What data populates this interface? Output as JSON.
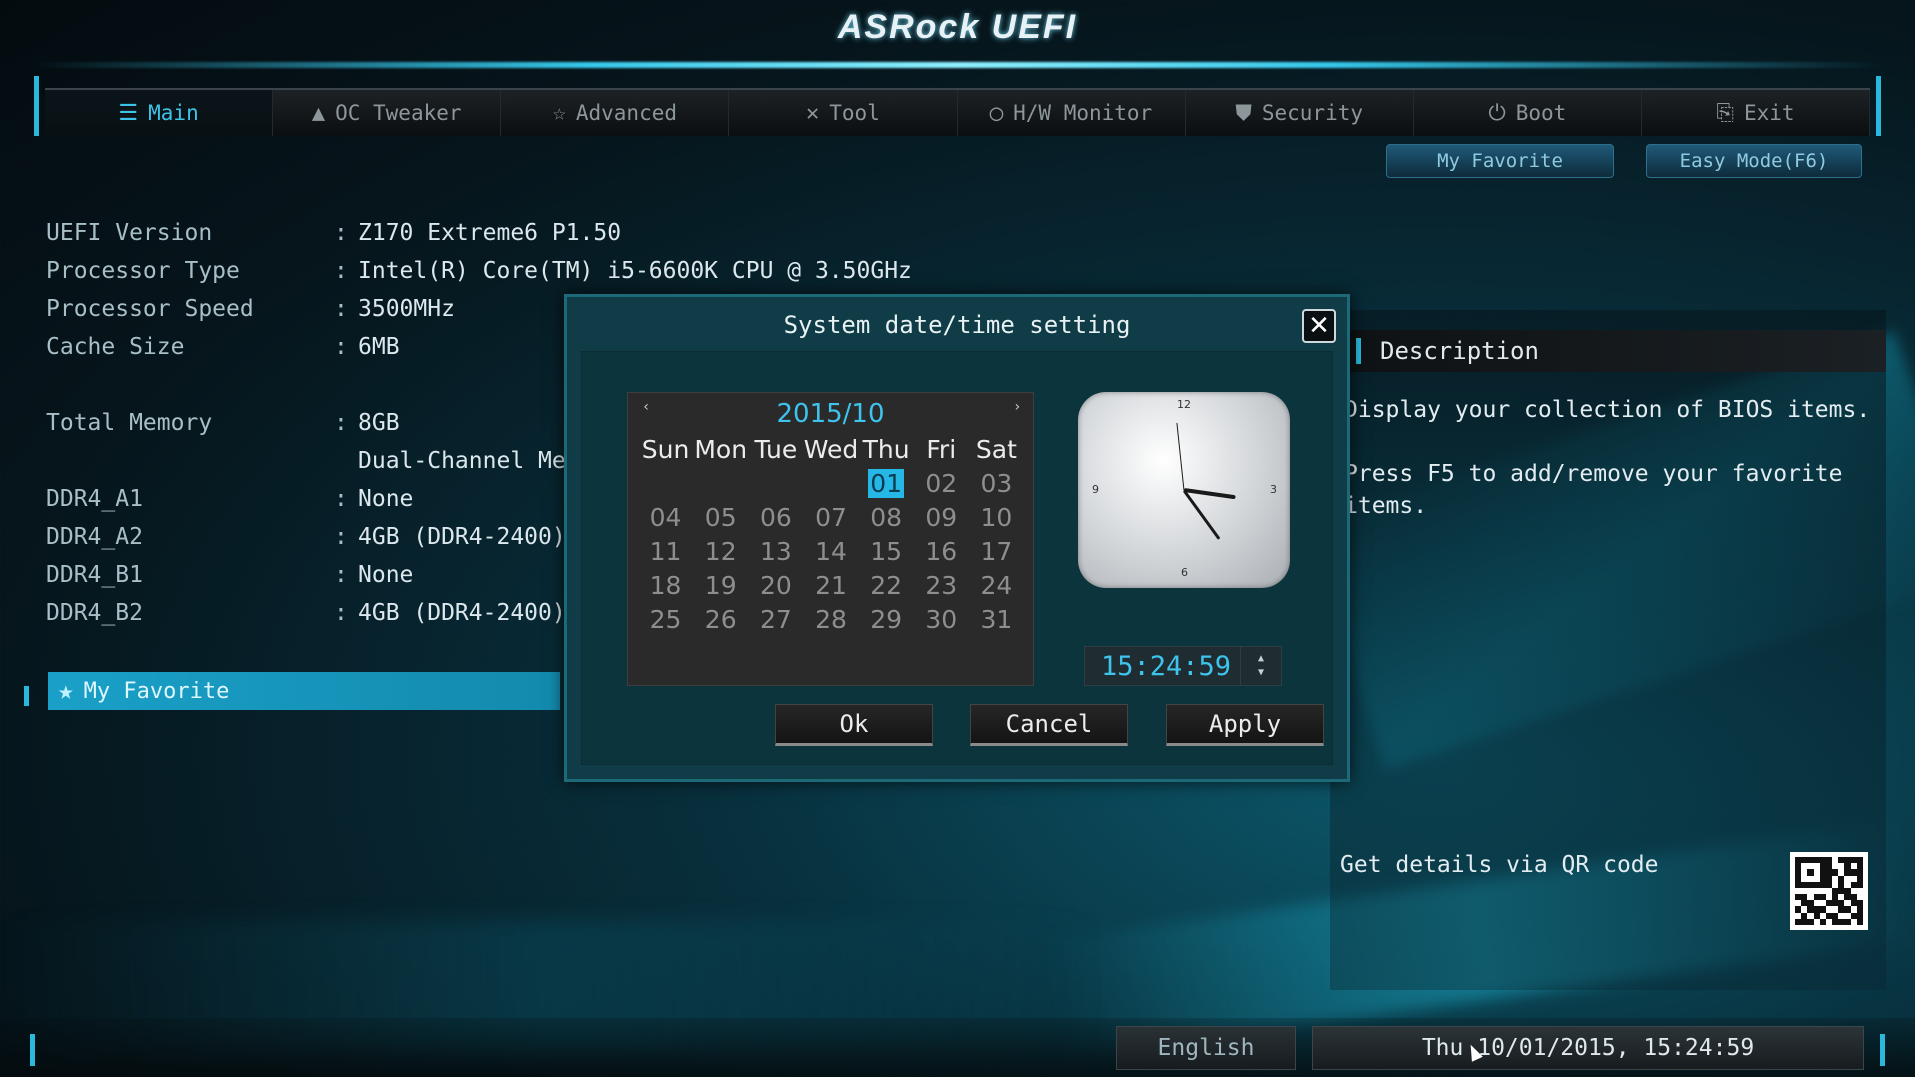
{
  "app": {
    "logo": "ASRock UEFI"
  },
  "tabs": [
    {
      "label": "Main",
      "icon": "list-icon",
      "glyph": "☰",
      "active": true
    },
    {
      "label": "OC Tweaker",
      "icon": "rocket-icon",
      "glyph": "▲"
    },
    {
      "label": "Advanced",
      "icon": "star-icon",
      "glyph": "☆"
    },
    {
      "label": "Tool",
      "icon": "tools-icon",
      "glyph": "✕"
    },
    {
      "label": "H/W Monitor",
      "icon": "monitor-icon",
      "glyph": "◯"
    },
    {
      "label": "Security",
      "icon": "shield-icon",
      "glyph": "⛊"
    },
    {
      "label": "Boot",
      "icon": "power-icon",
      "glyph": "⏻"
    },
    {
      "label": "Exit",
      "icon": "exit-icon",
      "glyph": "⎘"
    }
  ],
  "subbuttons": {
    "my_favorite": "My Favorite",
    "easy_mode": "Easy Mode(F6)"
  },
  "info": {
    "rows": [
      {
        "label": "UEFI Version",
        "sep": ":",
        "value": "Z170 Extreme6 P1.50"
      },
      {
        "label": "Processor Type",
        "sep": ":",
        "value": "Intel(R) Core(TM) i5-6600K CPU @ 3.50GHz"
      },
      {
        "label": "Processor Speed",
        "sep": ":",
        "value": "3500MHz"
      },
      {
        "label": "Cache Size",
        "sep": ":",
        "value": "6MB"
      },
      {
        "label": "Total Memory",
        "sep": ":",
        "value": "8GB"
      },
      {
        "label": "",
        "sep": "",
        "value": "Dual-Channel Memory Mode"
      },
      {
        "label": "DDR4_A1",
        "sep": ":",
        "value": "None"
      },
      {
        "label": "DDR4_A2",
        "sep": ":",
        "value": "4GB (DDR4-2400)"
      },
      {
        "label": "DDR4_B1",
        "sep": ":",
        "value": "None"
      },
      {
        "label": "DDR4_B2",
        "sep": ":",
        "value": "4GB (DDR4-2400)"
      }
    ],
    "favorite": "My Favorite"
  },
  "description": {
    "title": "Description",
    "line1": "Display your collection of BIOS items.",
    "line2": "Press F5 to add/remove your favorite items.",
    "qr_text": "Get details via QR code"
  },
  "bottom": {
    "language": "English",
    "datetime": "Thu 10/01/2015, 15:24:59"
  },
  "dialog": {
    "title": "System date/time setting",
    "close": "✕",
    "month": "2015/10",
    "prev": "‹",
    "next": "›",
    "weekdays": [
      "Sun",
      "Mon",
      "Tue",
      "Wed",
      "Thu",
      "Fri",
      "Sat"
    ],
    "leading_blanks": 4,
    "days": [
      "01",
      "02",
      "03",
      "04",
      "05",
      "06",
      "07",
      "08",
      "09",
      "10",
      "11",
      "12",
      "13",
      "14",
      "15",
      "16",
      "17",
      "18",
      "19",
      "20",
      "21",
      "22",
      "23",
      "24",
      "25",
      "26",
      "27",
      "28",
      "29",
      "30",
      "31"
    ],
    "selected_day": "01",
    "clock_numbers": {
      "n12": "12",
      "n3": "3",
      "n6": "6",
      "n9": "9"
    },
    "time": "15:24:59",
    "stepper_up": "▲",
    "stepper_down": "▼",
    "ok": "Ok",
    "cancel": "Cancel",
    "apply": "Apply"
  },
  "colors": {
    "accent": "#3ec3ec",
    "dialog_bg": "#0f3c46",
    "favorite_bar": "#1aa0c8"
  }
}
